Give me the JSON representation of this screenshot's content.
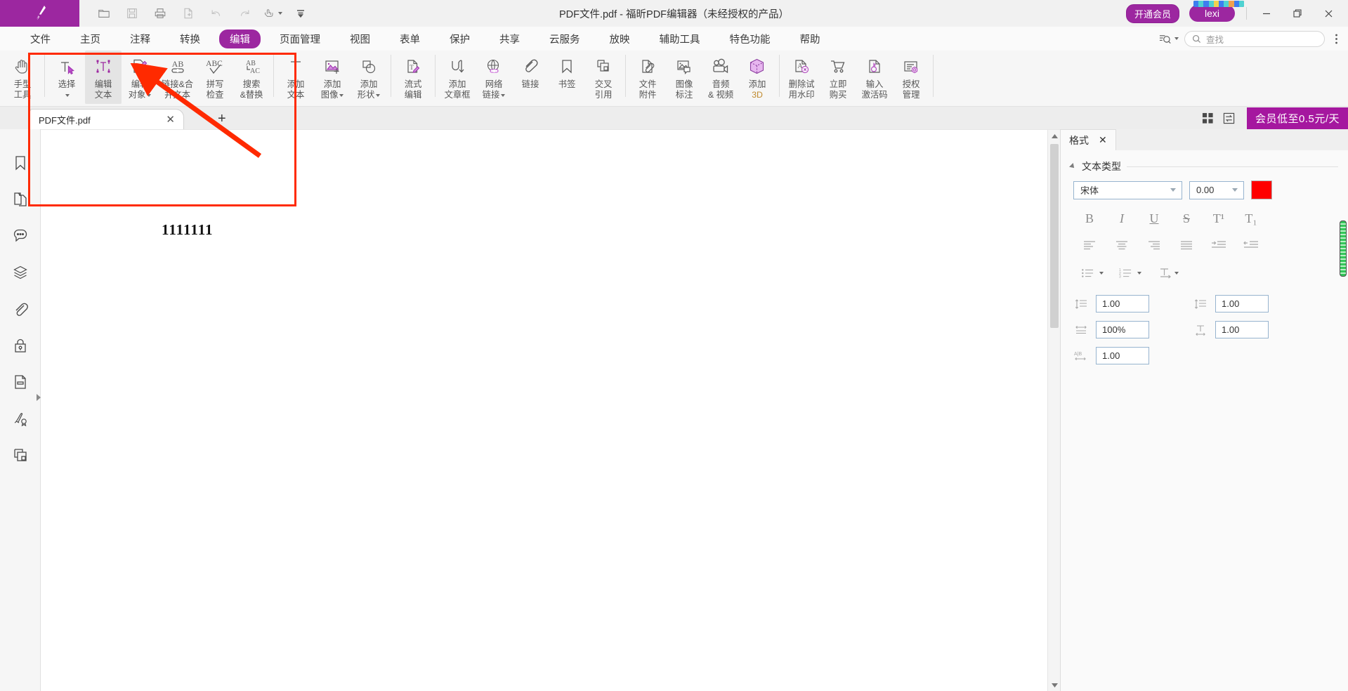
{
  "titlebar": {
    "title": "PDF文件.pdf - 福昕PDF编辑器（未经授权的产品）",
    "vip_button": "开通会员",
    "user_name": "lexi",
    "minimize": "—",
    "maximize": "❐",
    "close": "✕",
    "quick_access": [
      {
        "name": "open-icon",
        "tip": "打开"
      },
      {
        "name": "save-icon",
        "tip": "保存"
      },
      {
        "name": "print-icon",
        "tip": "打印"
      },
      {
        "name": "new-file-icon",
        "tip": "新建"
      },
      {
        "name": "undo-icon",
        "tip": "撤销"
      },
      {
        "name": "redo-icon",
        "tip": "重做"
      },
      {
        "name": "touch-mode-icon",
        "tip": "触控模式"
      },
      {
        "name": "customize-toolbar-icon",
        "tip": "自定义"
      }
    ]
  },
  "menubar": {
    "items": [
      {
        "label": "文件",
        "active": false
      },
      {
        "label": "主页",
        "active": false
      },
      {
        "label": "注释",
        "active": false
      },
      {
        "label": "转换",
        "active": false
      },
      {
        "label": "编辑",
        "active": true
      },
      {
        "label": "页面管理",
        "active": false
      },
      {
        "label": "视图",
        "active": false
      },
      {
        "label": "表单",
        "active": false
      },
      {
        "label": "保护",
        "active": false
      },
      {
        "label": "共享",
        "active": false
      },
      {
        "label": "云服务",
        "active": false
      },
      {
        "label": "放映",
        "active": false
      },
      {
        "label": "辅助工具",
        "active": false
      },
      {
        "label": "特色功能",
        "active": false
      },
      {
        "label": "帮助",
        "active": false
      }
    ],
    "search_placeholder": "查找",
    "search_value": "",
    "filter_icon": "search-filter-icon",
    "overflow_icon": "more-options-icon"
  },
  "ribbon": {
    "buttons": [
      {
        "l1": "手型",
        "l2": "工具",
        "icon": "hand-tool-icon",
        "dropdown": false,
        "selected": false
      },
      {
        "divider_after": false
      },
      {
        "l1": "选择",
        "l2": "",
        "icon": "select-text-icon",
        "dropdown": true,
        "selected": false
      },
      {
        "l1": "编辑",
        "l2": "文本",
        "icon": "edit-text-icon",
        "dropdown": false,
        "selected": true
      },
      {
        "l1": "编辑",
        "l2": "对象",
        "icon": "edit-object-icon",
        "dropdown": true,
        "selected": false
      },
      {
        "l1": "链接&合",
        "l2": "并文本",
        "icon": "link-merge-text-icon",
        "dropdown": false,
        "selected": false
      },
      {
        "l1": "拼写",
        "l2": "检查",
        "icon": "spell-check-icon",
        "dropdown": false,
        "selected": false
      },
      {
        "l1": "搜索",
        "l2": "&替换",
        "icon": "search-replace-icon",
        "dropdown": false,
        "selected": false
      },
      {
        "l1": "添加",
        "l2": "文本",
        "icon": "add-text-icon",
        "dropdown": false,
        "selected": false
      },
      {
        "l1": "添加",
        "l2": "图像",
        "icon": "add-image-icon",
        "dropdown": true,
        "selected": false
      },
      {
        "l1": "添加",
        "l2": "形状",
        "icon": "add-shape-icon",
        "dropdown": true,
        "selected": false
      },
      {
        "l1": "流式",
        "l2": "编辑",
        "icon": "flow-edit-icon",
        "dropdown": false,
        "selected": false
      },
      {
        "l1": "添加",
        "l2": "文章框",
        "icon": "add-article-box-icon",
        "dropdown": false,
        "selected": false
      },
      {
        "l1": "网络",
        "l2": "链接",
        "icon": "web-link-icon",
        "dropdown": true,
        "selected": false
      },
      {
        "l1": "链接",
        "l2": "",
        "icon": "link-icon",
        "dropdown": false,
        "selected": false
      },
      {
        "l1": "书签",
        "l2": "",
        "icon": "bookmark-icon",
        "dropdown": false,
        "selected": false
      },
      {
        "l1": "交叉",
        "l2": "引用",
        "icon": "cross-reference-icon",
        "dropdown": false,
        "selected": false
      },
      {
        "l1": "文件",
        "l2": "附件",
        "icon": "file-attachment-icon",
        "dropdown": false,
        "selected": false
      },
      {
        "l1": "图像",
        "l2": "标注",
        "icon": "image-annotation-icon",
        "dropdown": false,
        "selected": false
      },
      {
        "l1": "音频",
        "l2": "& 视频",
        "icon": "audio-video-icon",
        "dropdown": false,
        "selected": false
      },
      {
        "l1": "添加",
        "l2": "3D",
        "icon": "add-3d-icon",
        "dropdown": false,
        "selected": false
      },
      {
        "l1": "删除试",
        "l2": "用水印",
        "icon": "remove-watermark-icon",
        "dropdown": false,
        "selected": false
      },
      {
        "l1": "立即",
        "l2": "购买",
        "icon": "buy-now-icon",
        "dropdown": false,
        "selected": false
      },
      {
        "l1": "输入",
        "l2": "激活码",
        "icon": "enter-activation-code-icon",
        "dropdown": false,
        "selected": false
      },
      {
        "l1": "授权",
        "l2": "管理",
        "icon": "license-management-icon",
        "dropdown": false,
        "selected": false
      }
    ]
  },
  "tabstrip": {
    "document_tab": "PDF文件.pdf",
    "close_tab": "✕",
    "new_tab": "+",
    "grid_view_icon": "grid-view-icon",
    "split_view_icon": "split-view-icon",
    "vip_banner": "会员低至0.5元/天"
  },
  "leftnav": {
    "items": [
      {
        "name": "bookmarks-icon",
        "label": "书签"
      },
      {
        "name": "page-thumbnails-icon",
        "label": "页面缩略图"
      },
      {
        "name": "comments-icon",
        "label": "注释"
      },
      {
        "name": "layers-icon",
        "label": "图层"
      },
      {
        "name": "attachments-icon",
        "label": "附件"
      },
      {
        "name": "security-icon",
        "label": "安全"
      },
      {
        "name": "fields-icon",
        "label": "字段"
      },
      {
        "name": "signatures-icon",
        "label": "签名"
      },
      {
        "name": "stamps-icon",
        "label": "图章"
      }
    ],
    "expand_icon": "expand-panel-icon"
  },
  "document": {
    "content_text": "1111111",
    "scroll_up_icon": "scroll-up-icon",
    "scroll_down_icon": "scroll-down-icon"
  },
  "format_panel": {
    "tab_label": "格式",
    "tab_close": "✕",
    "section_title": "文本类型",
    "font_family": "宋体",
    "font_size": "0.00",
    "font_color_hex": "#FF0000",
    "style_buttons": [
      {
        "name": "bold-button",
        "glyph": "B"
      },
      {
        "name": "italic-button",
        "glyph": "I"
      },
      {
        "name": "underline-button",
        "glyph": "U"
      },
      {
        "name": "strikethrough-button",
        "glyph": "S"
      },
      {
        "name": "superscript-button",
        "glyph": "T¹"
      },
      {
        "name": "subscript-button",
        "glyph": "T₁"
      }
    ],
    "align_buttons": [
      {
        "name": "align-left-button"
      },
      {
        "name": "align-center-button"
      },
      {
        "name": "align-right-button"
      },
      {
        "name": "align-justify-button"
      },
      {
        "name": "increase-indent-button"
      },
      {
        "name": "decrease-indent-button"
      }
    ],
    "list_buttons": [
      {
        "name": "bulleted-list-button",
        "dropdown": true
      },
      {
        "name": "numbered-list-button",
        "dropdown": true
      },
      {
        "name": "text-direction-button",
        "dropdown": true
      }
    ],
    "spinners": [
      {
        "name": "line-spacing-before",
        "icon": "line-spacing-before-icon",
        "value": "1.00"
      },
      {
        "name": "line-spacing-after",
        "icon": "line-spacing-after-icon",
        "value": "1.00"
      },
      {
        "name": "horizontal-scale",
        "icon": "horizontal-scale-icon",
        "value": "100%"
      },
      {
        "name": "vertical-scale",
        "icon": "vertical-scale-icon",
        "value": "1.00"
      },
      {
        "name": "character-spacing",
        "icon": "character-spacing-icon",
        "value": "1.00"
      }
    ]
  },
  "annotation": {
    "highlight_color": "#FF2A00",
    "arrow_color": "#FF2A00"
  }
}
